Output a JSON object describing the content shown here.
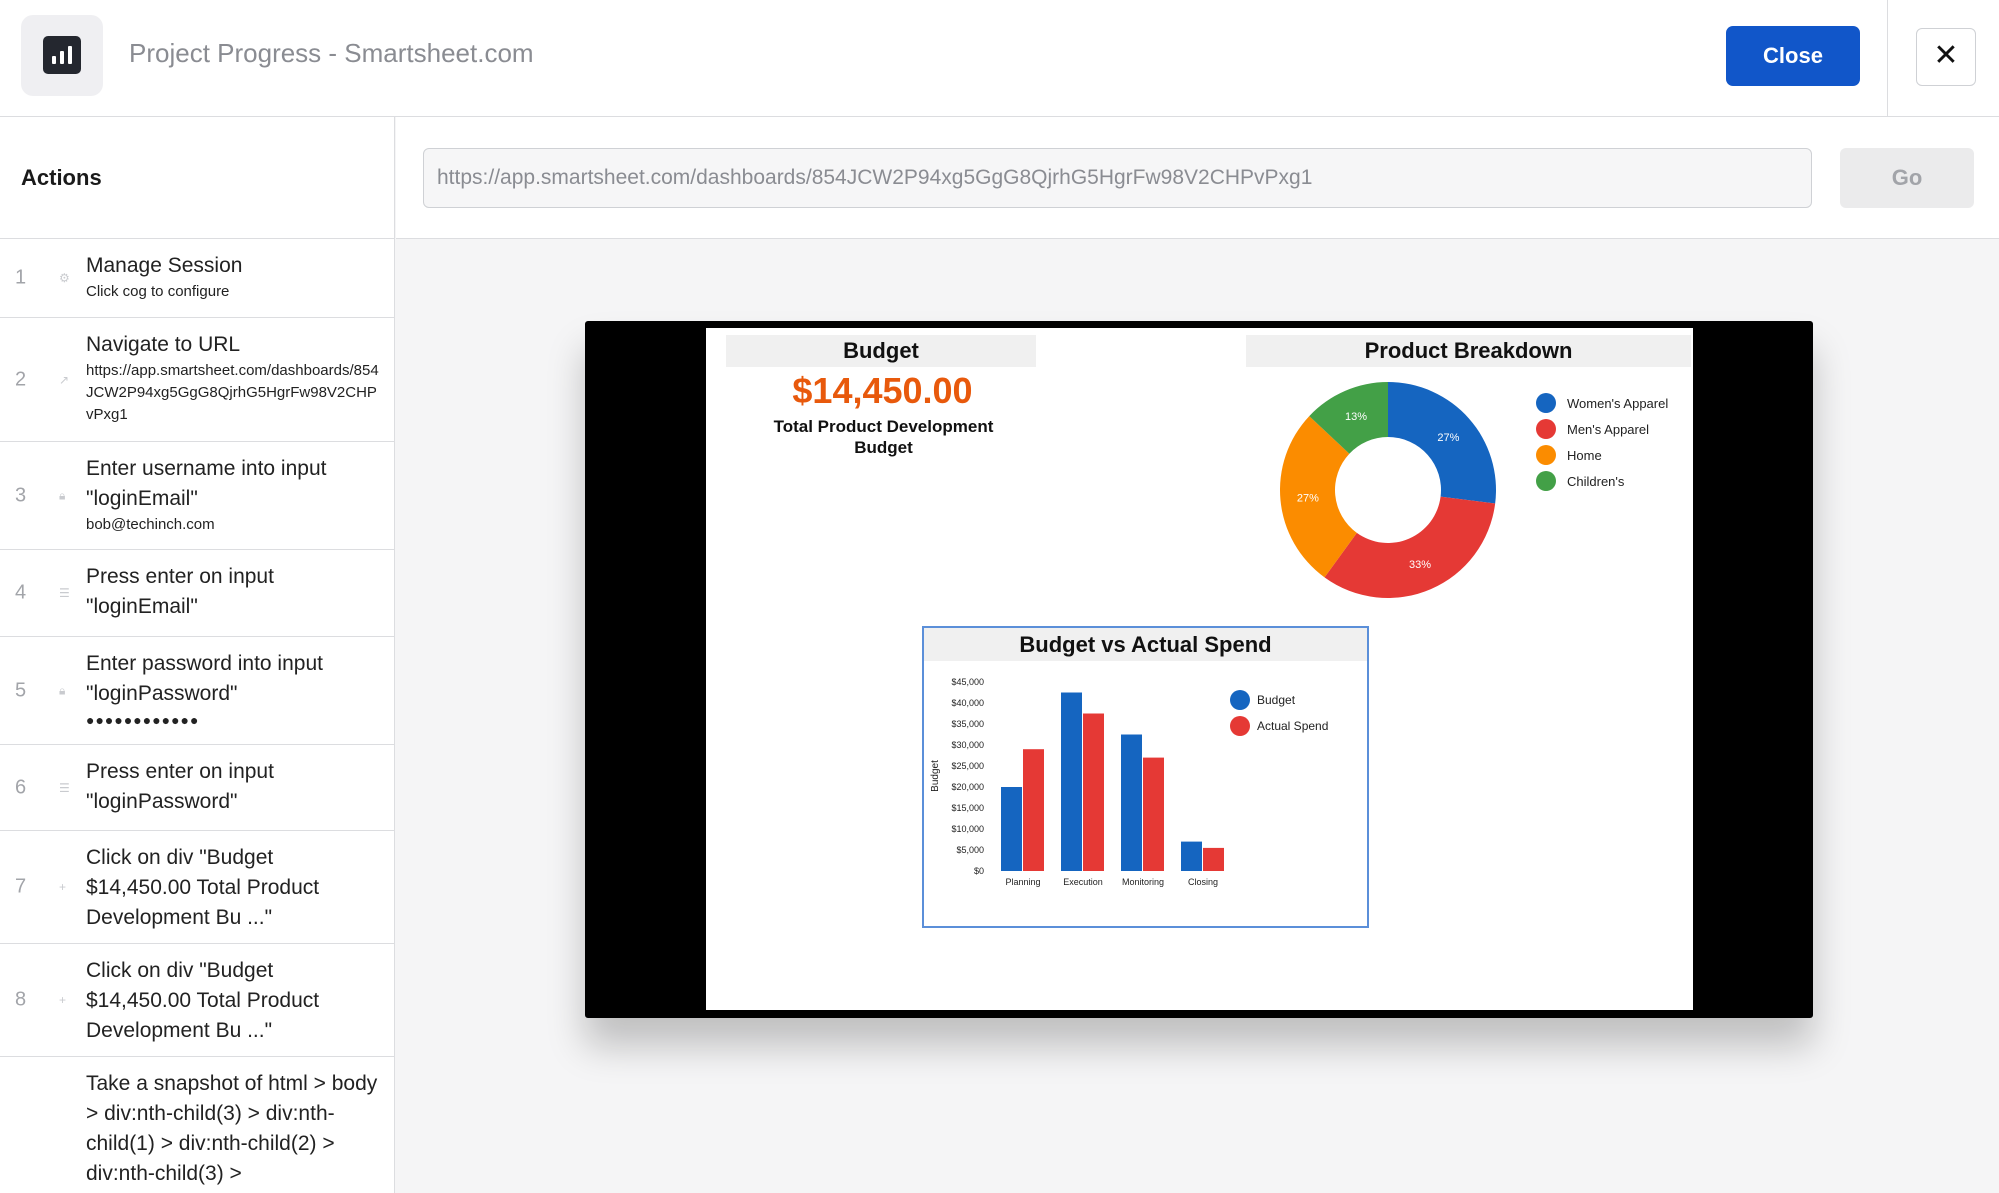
{
  "header": {
    "title": "Project Progress - Smartsheet.com",
    "app_icon": "bar-chart-icon",
    "close_label": "Close",
    "x_label": "✕"
  },
  "sidebar": {
    "heading": "Actions",
    "steps": [
      {
        "num": "1",
        "icon": "gear-icon",
        "title": "Manage Session",
        "sub": "Click cog to configure"
      },
      {
        "num": "2",
        "icon": "external-link-icon",
        "title": "Navigate to URL",
        "sub": "https://app.smartsheet.com/dashboards/854JCW2P94xg5GgG8QjrhG5HgrFw98V2CHPvPxg1"
      },
      {
        "num": "3",
        "icon": "lock-icon",
        "title": "Enter username into input \"loginEmail\"",
        "sub": "bob@techinch.com"
      },
      {
        "num": "4",
        "icon": "lines-icon",
        "title": "Press enter on input \"loginEmail\"",
        "sub": ""
      },
      {
        "num": "5",
        "icon": "lock-icon",
        "title": "Enter password into input \"loginPassword\"",
        "sub": "●●●●●●●●●●●●"
      },
      {
        "num": "6",
        "icon": "lines-icon",
        "title": "Press enter on input \"loginPassword\"",
        "sub": ""
      },
      {
        "num": "7",
        "icon": "pointer-icon",
        "title": "Click on div \"Budget $14,450.00 Total Product Development Bu ...\"",
        "sub": ""
      },
      {
        "num": "8",
        "icon": "pointer-icon",
        "title": "Click on div \"Budget $14,450.00 Total Product Development Bu ...\"",
        "sub": ""
      },
      {
        "num": "",
        "icon": "",
        "title": "Take a snapshot of html > body > div:nth-child(3) > div:nth-child(1) > div:nth-child(2) > div:nth-child(3) >",
        "sub": ""
      }
    ]
  },
  "urlbar": {
    "url": "https://app.smartsheet.com/dashboards/854JCW2P94xg5GgG8QjrhG5HgrFw98V2CHPvPxg1",
    "go_label": "Go"
  },
  "dashboard": {
    "budget": {
      "heading": "Budget",
      "amount": "$14,450.00",
      "label": "Total Product Development Budget"
    },
    "product_breakdown": {
      "heading": "Product Breakdown"
    },
    "budget_vs_actual": {
      "heading": "Budget vs Actual Spend"
    }
  },
  "colors": {
    "accent": "#1156c9",
    "blue": "#1565c0",
    "red": "#e53935",
    "orange": "#fb8c00",
    "green": "#43a047",
    "budget_orange": "#e8590c"
  },
  "chart_data": [
    {
      "type": "pie",
      "title": "Product Breakdown",
      "donut": true,
      "categories": [
        "Women's Apparel",
        "Men's Apparel",
        "Home",
        "Children's"
      ],
      "values": [
        27,
        33,
        27,
        13
      ],
      "labels": [
        "27%",
        "33%",
        "27%",
        "13%"
      ],
      "legend_position": "right"
    },
    {
      "type": "bar",
      "title": "Budget vs Actual Spend",
      "categories": [
        "Planning",
        "Execution",
        "Monitoring",
        "Closing"
      ],
      "series": [
        {
          "name": "Budget",
          "values": [
            20000,
            42500,
            32500,
            7000
          ]
        },
        {
          "name": "Actual Spend",
          "values": [
            29000,
            37500,
            27000,
            5500
          ]
        }
      ],
      "ylabel": "Budget",
      "ylim": [
        0,
        45000
      ],
      "yticks": [
        "$0",
        "$5,000",
        "$10,000",
        "$15,000",
        "$20,000",
        "$25,000",
        "$30,000",
        "$35,000",
        "$40,000",
        "$45,000"
      ],
      "grid": false,
      "legend_position": "top-right"
    }
  ]
}
